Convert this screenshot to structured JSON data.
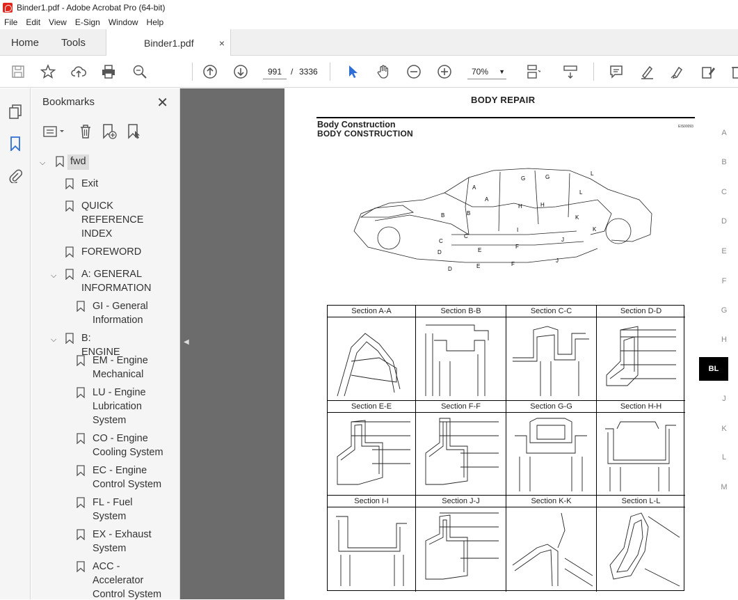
{
  "window": {
    "title": "Binder1.pdf - Adobe Acrobat Pro (64-bit)"
  },
  "menu": [
    "File",
    "Edit",
    "View",
    "E-Sign",
    "Window",
    "Help"
  ],
  "tabs": {
    "home": "Home",
    "tools": "Tools",
    "document": "Binder1.pdf",
    "close": "×"
  },
  "toolbar": {
    "page_current": "991",
    "page_separator": "/",
    "page_total": "3336",
    "zoom": "70%"
  },
  "bookmarks": {
    "title": "Bookmarks",
    "items": [
      {
        "label": "fwd",
        "level": 0,
        "expanded": true
      },
      {
        "label": "Exit",
        "level": 1
      },
      {
        "label": "QUICK\nREFERENCE\nINDEX",
        "level": 1
      },
      {
        "label": "FOREWORD",
        "level": 1
      },
      {
        "label": "A: GENERAL\nINFORMATION",
        "level": 1,
        "expanded": true
      },
      {
        "label": "GI - General\nInformation",
        "level": 2
      },
      {
        "label": "B: ENGINE",
        "level": 1,
        "expanded": true
      },
      {
        "label": "EM - Engine\nMechanical",
        "level": 2
      },
      {
        "label": "LU - Engine\nLubrication\nSystem",
        "level": 2
      },
      {
        "label": "CO - Engine\nCooling System",
        "level": 2
      },
      {
        "label": "EC - Engine\nControl System",
        "level": 2
      },
      {
        "label": "FL - Fuel\nSystem",
        "level": 2
      },
      {
        "label": "EX - Exhaust\nSystem",
        "level": 2
      },
      {
        "label": "ACC -\nAccelerator\nControl System",
        "level": 2
      }
    ]
  },
  "page": {
    "header": "BODY REPAIR",
    "heading": "Body Construction",
    "subheading": "BODY CONSTRUCTION",
    "code": "EIS00093",
    "diagram_labels": [
      "A",
      "A",
      "B",
      "B",
      "C",
      "C",
      "D",
      "D",
      "E",
      "E",
      "F",
      "F",
      "G",
      "G",
      "H",
      "H",
      "I",
      "J",
      "J",
      "K",
      "K",
      "L",
      "L"
    ],
    "sections": [
      "Section A-A",
      "Section B-B",
      "Section C-C",
      "Section D-D",
      "Section E-E",
      "Section F-F",
      "Section G-G",
      "Section H-H",
      "Section I-I",
      "Section J-J",
      "Section K-K",
      "Section L-L"
    ],
    "index_letters": [
      "A",
      "B",
      "C",
      "D",
      "E",
      "F",
      "G",
      "H",
      "BL",
      "J",
      "K",
      "L",
      "M"
    ],
    "active_index": "BL"
  }
}
